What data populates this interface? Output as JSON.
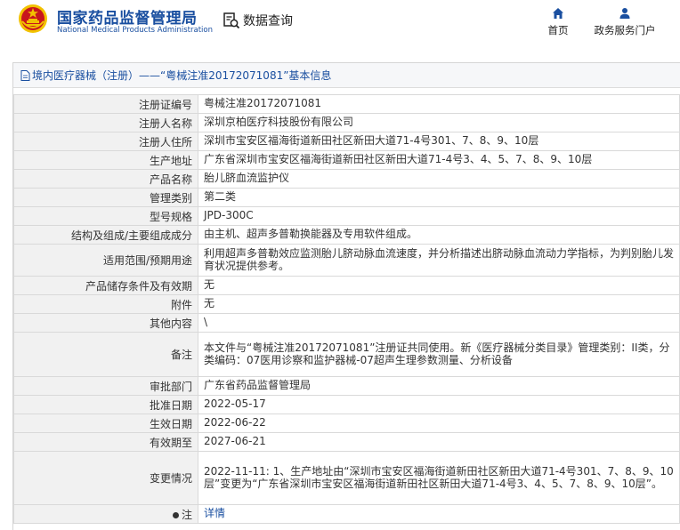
{
  "header": {
    "logo_cn": "国家药品监督管理局",
    "logo_en": "National Medical Products Administration",
    "data_query": "数据查询",
    "nav_home": "首页",
    "nav_portal": "政务服务门户"
  },
  "breadcrumb": {
    "category": "境内医疗器械（注册）",
    "separator": "——",
    "record_title": "“粤械注准20172071081”基本信息"
  },
  "details": [
    {
      "label": "注册证编号",
      "value": "粤械注准20172071081"
    },
    {
      "label": "注册人名称",
      "value": "深圳京柏医疗科技股份有限公司"
    },
    {
      "label": "注册人住所",
      "value": "深圳市宝安区福海街道新田社区新田大道71-4号301、7、8、9、10层"
    },
    {
      "label": "生产地址",
      "value": "广东省深圳市宝安区福海街道新田社区新田大道71-4号3、4、5、7、8、9、10层"
    },
    {
      "label": "产品名称",
      "value": "胎儿脐血流监护仪"
    },
    {
      "label": "管理类别",
      "value": "第二类"
    },
    {
      "label": "型号规格",
      "value": "JPD-300C"
    },
    {
      "label": "结构及组成/主要组成成分",
      "value": "由主机、超声多普勒换能器及专用软件组成。"
    },
    {
      "label": "适用范围/预期用途",
      "value": "利用超声多普勒效应监测胎儿脐动脉血流速度，并分析描述出脐动脉血流动力学指标，为判别胎儿发育状况提供参考。"
    },
    {
      "label": "产品储存条件及有效期",
      "value": "无"
    },
    {
      "label": "附件",
      "value": "无"
    },
    {
      "label": "其他内容",
      "value": "\\"
    },
    {
      "label": "备注",
      "value": "本文件与“粤械注准20172071081”注册证共同使用。新《医疗器械分类目录》管理类别：II类，分类编码：07医用诊察和监护器械-07超声生理参数测量、分析设备"
    },
    {
      "label": "审批部门",
      "value": "广东省药品监督管理局"
    },
    {
      "label": "批准日期",
      "value": "2022-05-17"
    },
    {
      "label": "生效日期",
      "value": "2022-06-22"
    },
    {
      "label": "有效期至",
      "value": "2027-06-21"
    },
    {
      "label": "变更情况",
      "value": "2022-11-11: 1、生产地址由“深圳市宝安区福海街道新田社区新田大道71-4号301、7、8、9、10层”变更为“广东省深圳市宝安区福海街道新田社区新田大道71-4号3、4、5、7、8、9、10层”。"
    }
  ],
  "note": {
    "label": "注",
    "link": "详情"
  },
  "colors": {
    "brand_blue": "#1a4fa0",
    "label_bg": "#f1f1f1",
    "border": "#d9d9d9",
    "emblem_red": "#c8161d",
    "emblem_gold": "#f2c200"
  }
}
